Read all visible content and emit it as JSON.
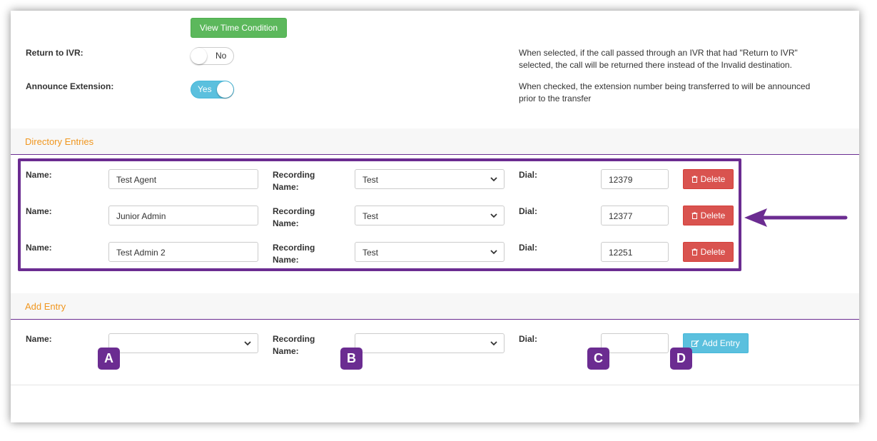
{
  "top": {
    "time_condition_button": "View Time Condition",
    "return_ivr": {
      "label": "Return to IVR:",
      "toggle": "No",
      "description_line1": "When selected, if the call passed through an IVR that had \"Return to IVR\"",
      "description_line2": "selected, the call will be returned there instead of the Invalid destination."
    },
    "announce": {
      "label": "Announce Extension:",
      "toggle": "Yes",
      "description_line1": "When checked, the extension number being transferred to will be announced",
      "description_line2": "prior to the transfer"
    }
  },
  "directory": {
    "title": "Directory Entries",
    "name_label": "Name:",
    "recording_label_line1": "Recording",
    "recording_label_line2": "Name:",
    "dial_label": "Dial:",
    "delete_label": "Delete",
    "entries": [
      {
        "name": "Test Agent",
        "recording": "Test",
        "dial": "12379"
      },
      {
        "name": "Junior Admin",
        "recording": "Test",
        "dial": "12377"
      },
      {
        "name": "Test Admin 2",
        "recording": "Test",
        "dial": "12251"
      }
    ]
  },
  "add_entry": {
    "title": "Add Entry",
    "name_label": "Name:",
    "recording_label_line1": "Recording",
    "recording_label_line2": "Name:",
    "dial_label": "Dial:",
    "button": "Add Entry",
    "name_value": "",
    "recording_value": "",
    "dial_value": ""
  },
  "callouts": {
    "a": "A",
    "b": "B",
    "c": "C",
    "d": "D"
  },
  "colors": {
    "accent_purple": "#6b2c91",
    "section_title_orange": "#f0961e",
    "green_button": "#5cb85c",
    "delete_red": "#d9534f",
    "info_blue": "#5bc0de"
  },
  "icons": {
    "delete": "trash-icon",
    "add": "edit-icon",
    "select": "chevron-down-icon",
    "arrow": "arrow-left-icon"
  }
}
